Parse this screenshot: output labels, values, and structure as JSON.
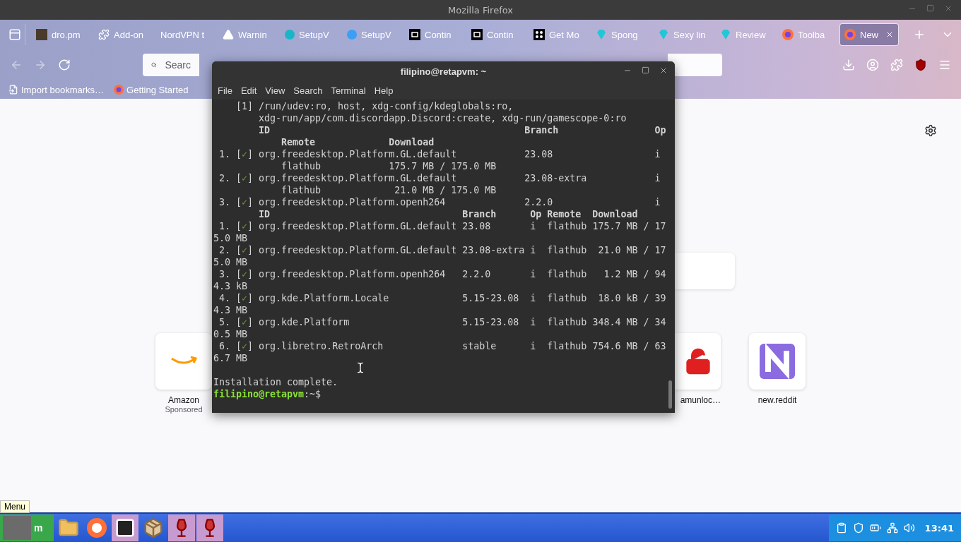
{
  "firefox": {
    "title": "Mozilla Firefox",
    "tabs": [
      {
        "label": "dro.pm",
        "kind": "thumbnail",
        "selected": false
      },
      {
        "label": "Add-on",
        "kind": "puzzle",
        "selected": false
      },
      {
        "label": "NordVPN t",
        "kind": "plain",
        "selected": false
      },
      {
        "label": "Warnin",
        "kind": "warning",
        "selected": false
      },
      {
        "label": "SetupV",
        "kind": "circle",
        "color": "#19b5c9",
        "selected": false
      },
      {
        "label": "SetupV",
        "kind": "circle",
        "color": "#3a9ff5",
        "selected": false
      },
      {
        "label": "Contin",
        "kind": "square",
        "selected": false
      },
      {
        "label": "Contin",
        "kind": "square",
        "selected": false
      },
      {
        "label": "Get Mo",
        "kind": "dots",
        "selected": false
      },
      {
        "label": "Spong",
        "kind": "gem",
        "selected": false
      },
      {
        "label": "Sexy lin",
        "kind": "gem",
        "selected": false
      },
      {
        "label": "Review",
        "kind": "gem",
        "selected": false
      },
      {
        "label": "Toolba",
        "kind": "firefox",
        "selected": false
      },
      {
        "label": "New",
        "kind": "firefox",
        "selected": true
      }
    ],
    "search": {
      "placeholder": "Searc"
    },
    "bookmarks": [
      {
        "label": "Import bookmarks…",
        "kind": "import"
      },
      {
        "label": "Getting Started",
        "kind": "firefox"
      }
    ],
    "shortcuts_left": [
      {
        "label": "Amazon",
        "sponsor": "Sponsored",
        "kind": "amazon"
      }
    ],
    "shortcuts_right": [
      {
        "label": "amunloc…",
        "kind": "lock"
      },
      {
        "label": "new.reddit",
        "kind": "tile"
      }
    ]
  },
  "terminal": {
    "title": "filipino@retapvm: ~",
    "menu": [
      "File",
      "Edit",
      "View",
      "Search",
      "Terminal",
      "Help"
    ],
    "lines": [
      {
        "kind": "text",
        "text": "    [1] /run/udev:ro, host, xdg-config/kdeglobals:ro,"
      },
      {
        "kind": "text",
        "text": "        xdg-run/app/com.discordapp.Discord:create, xdg-run/gamescope-0:ro"
      },
      {
        "kind": "header",
        "text": "        ID                                             Branch                 Op"
      },
      {
        "kind": "header",
        "text": "            Remote             Download"
      },
      {
        "kind": "item",
        "before": " 1. [",
        "mark": "✓",
        "checked": true,
        "after": "] org.freedesktop.Platform.GL.default            23.08                  i"
      },
      {
        "kind": "text",
        "text": "            flathub            175.7 MB / 175.0 MB"
      },
      {
        "kind": "item",
        "before": " 2. [",
        "mark": "✓",
        "checked": true,
        "after": "] org.freedesktop.Platform.GL.default            23.08-extra            i"
      },
      {
        "kind": "text",
        "text": "            flathub             21.0 MB / 175.0 MB"
      },
      {
        "kind": "item",
        "before": " 3. [",
        "mark": "✓",
        "checked": true,
        "after": "] org.freedesktop.Platform.openh264              2.2.0                  i"
      },
      {
        "kind": "header",
        "text": "        ID                                  Branch      Op Remote  Download"
      },
      {
        "kind": "item",
        "before": " 1. [",
        "mark": "✓",
        "checked": true,
        "after": "] org.freedesktop.Platform.GL.default 23.08       i  flathub 175.7 MB / 17"
      },
      {
        "kind": "text",
        "text": "5.0 MB"
      },
      {
        "kind": "item",
        "before": " 2. [",
        "mark": "✓",
        "checked": true,
        "after": "] org.freedesktop.Platform.GL.default 23.08-extra i  flathub  21.0 MB / 17"
      },
      {
        "kind": "text",
        "text": "5.0 MB"
      },
      {
        "kind": "item",
        "before": " 3. [",
        "mark": "✓",
        "checked": true,
        "after": "] org.freedesktop.Platform.openh264   2.2.0       i  flathub   1.2 MB / 94"
      },
      {
        "kind": "text",
        "text": "4.3 kB"
      },
      {
        "kind": "item",
        "before": " 4. [",
        "mark": "✓",
        "checked": true,
        "after": "] org.kde.Platform.Locale             5.15-23.08  i  flathub  18.0 kB / 39"
      },
      {
        "kind": "text",
        "text": "4.3 MB"
      },
      {
        "kind": "item",
        "before": " 5. [",
        "mark": "✓",
        "checked": true,
        "after": "] org.kde.Platform                    5.15-23.08  i  flathub 348.4 MB / 34"
      },
      {
        "kind": "text",
        "text": "0.5 MB"
      },
      {
        "kind": "item",
        "before": " 6. [",
        "mark": "✓",
        "checked": true,
        "after": "] org.libretro.RetroArch              stable      i  flathub 754.6 MB / 63"
      },
      {
        "kind": "text",
        "text": "6.7 MB"
      },
      {
        "kind": "blank"
      },
      {
        "kind": "text",
        "text": "Installation complete."
      },
      {
        "kind": "prompt",
        "user": "filipino@retapvm",
        "suffix": ":~$"
      }
    ]
  },
  "taskbar": {
    "tooltip": "Menu",
    "start_label": "m",
    "launchers": [
      {
        "kind": "folder",
        "running": false
      },
      {
        "kind": "firefox",
        "running": false
      },
      {
        "kind": "terminal",
        "running": true
      },
      {
        "kind": "box",
        "running": false
      },
      {
        "kind": "wine",
        "running": true
      },
      {
        "kind": "wine",
        "running": true
      }
    ],
    "clock": "13:41"
  }
}
